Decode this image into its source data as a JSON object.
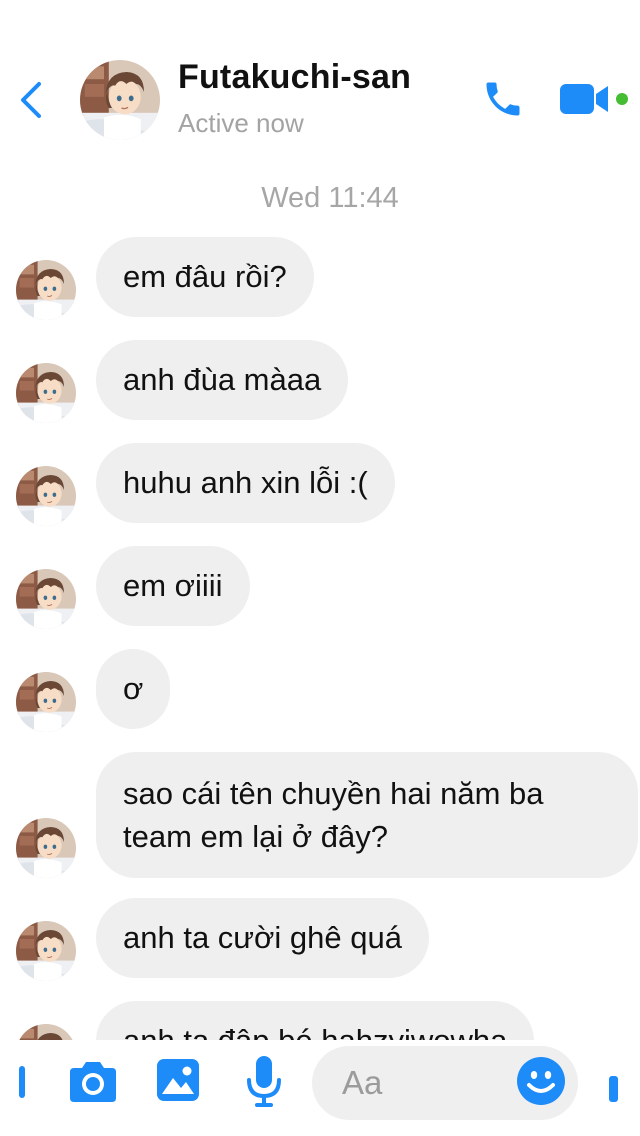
{
  "header": {
    "back_icon": "chevron-left-icon",
    "contact_name": "Futakuchi-san",
    "status": "Active now",
    "call_icon": "phone-icon",
    "video_icon": "video-camera-icon",
    "online_dot_color": "#44bd32"
  },
  "conversation": {
    "timestamp": "Wed 11:44",
    "messages": [
      {
        "text": "em đâu rồi?"
      },
      {
        "text": "anh đùa màaa"
      },
      {
        "text": "huhu anh xin lỗi :("
      },
      {
        "text": "em ơiiii"
      },
      {
        "text": "ơ"
      },
      {
        "text": "sao cái tên chuyền hai năm ba team em lại ở đây?"
      },
      {
        "text": "anh ta cười ghê quá"
      },
      {
        "text": "anh ta đập bé hahzyiwowha"
      }
    ]
  },
  "composer": {
    "placeholder": "Aa",
    "icons": [
      "more-icon",
      "camera-icon",
      "image-icon",
      "microphone-icon",
      "emoji-icon",
      "like-icon"
    ]
  },
  "colors": {
    "accent": "#1d8cf8",
    "bubble_bg": "#efefef",
    "secondary_text": "#a3a3a3"
  }
}
